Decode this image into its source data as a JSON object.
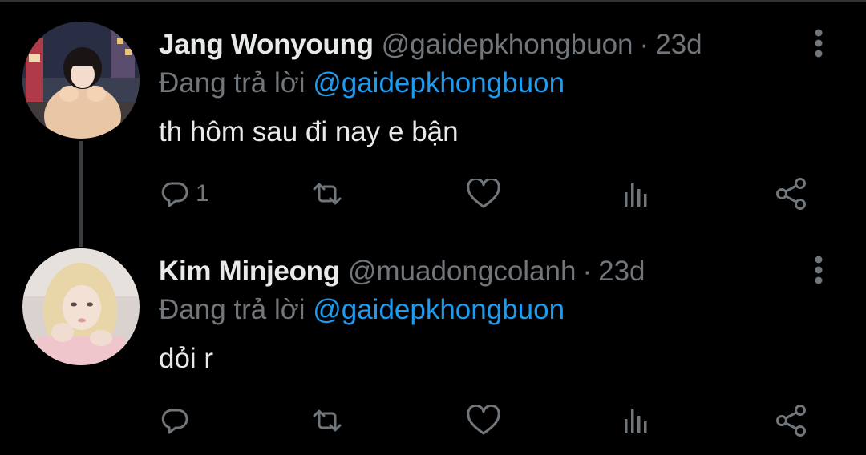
{
  "tweets": [
    {
      "name": "Jang Wonyoung",
      "handle": "@gaidepkhongbuon",
      "separator": "·",
      "time": "23d",
      "reply_prefix": "Đang trả lời",
      "reply_to": "@gaidepkhongbuon",
      "text": "th hôm sau đi nay e bận",
      "reply_count": "1",
      "icons": [
        "more-icon",
        "reply-icon",
        "retweet-icon",
        "like-icon",
        "views-icon",
        "share-icon"
      ]
    },
    {
      "name": "Kim Minjeong",
      "handle": "@muadongcolanh",
      "separator": "·",
      "time": "23d",
      "reply_prefix": "Đang trả lời",
      "reply_to": "@gaidepkhongbuon",
      "text": "dỏi r",
      "reply_count": "",
      "icons": [
        "more-icon",
        "reply-icon",
        "retweet-icon",
        "like-icon",
        "views-icon",
        "share-icon"
      ]
    }
  ],
  "colors": {
    "background": "#000000",
    "primary_text": "#e7e9ea",
    "secondary_text": "#71767b",
    "link": "#1d9bf0",
    "thread_line": "#3a3d40"
  }
}
